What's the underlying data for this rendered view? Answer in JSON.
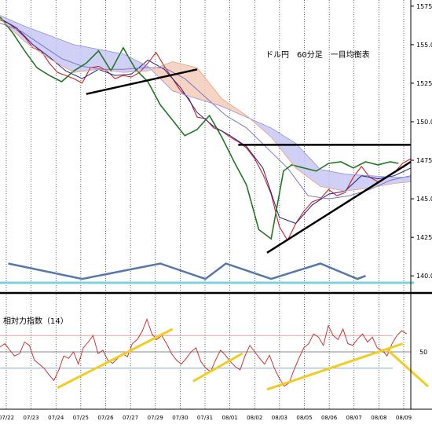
{
  "chart_data": {
    "type": "line",
    "title": "ドル円　60分足　一目均衡表",
    "price_axis": {
      "ticks": [
        157.5,
        155.0,
        152.5,
        150.0,
        147.5,
        145.0,
        142.5,
        140.0
      ],
      "tick_labels": [
        "1575",
        "155.0",
        "1525",
        "150.0",
        "1475",
        "145.0",
        "1425",
        "140.0"
      ],
      "ylim": [
        139.5,
        157.9
      ]
    },
    "dates": [
      "07/22",
      "07/23",
      "07/24",
      "07/25",
      "07/26",
      "07/27",
      "07/29",
      "07/30",
      "07/31",
      "08/01",
      "08/02",
      "08/03",
      "08/05",
      "08/06",
      "08/07",
      "08/08",
      "08/09"
    ],
    "series": [
      {
        "role": "price",
        "color": "#cc2222",
        "x": [
          0,
          2,
          4,
          6,
          8,
          10,
          12,
          14,
          16,
          18,
          20,
          22,
          24,
          26,
          28,
          30,
          32,
          34,
          36,
          38,
          40,
          42,
          44,
          46,
          48,
          50,
          52,
          54,
          56,
          58,
          60,
          62,
          64,
          66,
          68,
          70,
          72,
          74,
          76,
          78,
          80,
          82,
          84,
          86,
          88,
          90,
          92,
          94,
          96,
          98,
          100
        ],
        "y": [
          156.6,
          156.4,
          156.0,
          155.5,
          154.8,
          154.6,
          153.8,
          153.2,
          153.0,
          152.8,
          152.5,
          153.5,
          153.6,
          153.3,
          152.8,
          153.0,
          152.9,
          153.2,
          153.8,
          154.5,
          153.6,
          152.8,
          152.0,
          151.5,
          150.3,
          150.2,
          149.6,
          149.4,
          149.0,
          148.7,
          148.3,
          147.6,
          146.6,
          145.3,
          143.2,
          142.3,
          143.4,
          144.2,
          144.8,
          145.0,
          145.6,
          145.2,
          145.4,
          146.4,
          147.1,
          146.4,
          146.1,
          146.4,
          146.7,
          147.3,
          147.6
        ]
      },
      {
        "role": "tenkan",
        "color": "#22228a",
        "x": [
          0,
          4,
          8,
          12,
          16,
          20,
          24,
          28,
          32,
          36,
          40,
          44,
          48,
          52,
          56,
          60,
          64,
          68,
          72,
          76,
          80,
          84,
          88,
          92,
          96,
          100
        ],
        "y": [
          156.7,
          156.1,
          155.0,
          154.2,
          153.3,
          152.8,
          153.4,
          153.0,
          153.1,
          154.0,
          153.4,
          152.2,
          150.6,
          149.7,
          149.1,
          148.4,
          147.0,
          143.8,
          143.4,
          144.6,
          145.3,
          145.5,
          146.5,
          146.3,
          146.5,
          147.0
        ]
      },
      {
        "role": "kijun",
        "color": "#7777c8",
        "x": [
          0,
          5,
          10,
          15,
          20,
          25,
          30,
          35,
          40,
          45,
          50,
          55,
          60,
          65,
          70,
          75,
          80,
          85,
          90,
          95,
          100
        ],
        "y": [
          156.4,
          155.9,
          155.0,
          154.1,
          153.6,
          153.4,
          153.4,
          153.5,
          153.5,
          152.8,
          151.6,
          150.4,
          149.6,
          148.3,
          147.0,
          145.2,
          145.0,
          145.2,
          145.6,
          146.2,
          146.5
        ]
      },
      {
        "role": "chikou",
        "color": "#227722",
        "x": [
          0,
          3,
          6,
          9,
          12,
          15,
          18,
          21,
          24,
          27,
          30,
          33,
          36,
          39,
          42,
          45,
          48,
          51,
          54,
          57,
          60,
          63,
          66,
          69,
          71,
          74,
          77,
          80,
          83,
          86,
          89,
          92,
          95,
          97
        ],
        "y": [
          156.8,
          155.8,
          154.6,
          153.5,
          153.0,
          152.6,
          153.3,
          153.8,
          154.6,
          153.3,
          154.8,
          153.4,
          152.6,
          151.1,
          150.1,
          149.1,
          149.5,
          150.4,
          149.0,
          147.4,
          145.9,
          143.0,
          142.4,
          146.8,
          147.2,
          147.0,
          146.8,
          147.3,
          147.4,
          147.0,
          147.4,
          147.2,
          147.4,
          147.3
        ]
      },
      {
        "role": "senkou_a",
        "color": "#e8a080",
        "x": [
          0,
          6,
          12,
          18,
          24,
          30,
          36,
          42,
          48,
          54,
          60,
          66,
          72,
          78,
          84,
          90,
          96,
          100
        ],
        "y": [
          156.7,
          155.2,
          154.1,
          153.2,
          153.4,
          153.2,
          153.3,
          153.9,
          153.5,
          151.5,
          150.4,
          149.0,
          147.0,
          145.8,
          145.5,
          145.7,
          146.0,
          146.1
        ]
      },
      {
        "role": "senkou_b",
        "color": "#9090d8",
        "x": [
          0,
          6,
          12,
          18,
          24,
          30,
          36,
          42,
          48,
          54,
          60,
          66,
          72,
          78,
          84,
          90,
          96,
          100
        ],
        "y": [
          156.9,
          156.2,
          155.6,
          155.0,
          154.7,
          154.4,
          153.6,
          152.0,
          151.5,
          151.0,
          150.3,
          149.6,
          148.6,
          146.9,
          146.6,
          146.5,
          146.4,
          146.4
        ]
      }
    ],
    "resistance_line": {
      "y": 148.5,
      "x": [
        58,
        100
      ]
    },
    "support_lines": [
      {
        "from": [
          21,
          151.8
        ],
        "to": [
          48,
          153.4
        ]
      },
      {
        "from": [
          65,
          141.5
        ],
        "to": [
          100,
          147.4
        ]
      }
    ],
    "cycle_wave": {
      "color": "#5577aa",
      "points": [
        [
          2,
          140.8
        ],
        [
          20,
          139.8
        ],
        [
          39,
          140.8
        ],
        [
          50,
          139.8
        ],
        [
          55,
          140.8
        ],
        [
          66,
          139.8
        ],
        [
          78,
          140.8
        ],
        [
          87,
          139.8
        ],
        [
          89,
          140.0
        ]
      ]
    },
    "rsi": {
      "label": "相対力指数（14）",
      "upper": 70,
      "lower": 30,
      "mid_value_label": "50",
      "values": [
        56,
        60,
        52,
        45,
        48,
        62,
        58,
        40,
        35,
        30,
        22,
        15,
        28,
        45,
        42,
        50,
        35,
        55,
        62,
        70,
        48,
        52,
        40,
        36,
        42,
        48,
        44,
        60,
        65,
        75,
        90,
        72,
        65,
        70,
        60,
        48,
        40,
        35,
        42,
        50,
        55,
        38,
        30,
        26,
        40,
        52,
        46,
        38,
        32,
        28,
        45,
        58,
        50,
        42,
        35,
        46,
        30,
        18,
        8,
        12,
        28,
        42,
        55,
        60,
        72,
        68,
        58,
        82,
        70,
        65,
        78,
        60,
        58,
        66,
        72,
        62,
        68,
        55,
        52,
        45,
        60,
        70,
        76,
        72
      ],
      "trend_lines": [
        {
          "from": [
            14,
            6
          ],
          "to": [
            42,
            78
          ]
        },
        {
          "from": [
            47,
            14
          ],
          "to": [
            59,
            48
          ]
        },
        {
          "from": [
            65,
            4
          ],
          "to": [
            98,
            60
          ]
        }
      ]
    }
  }
}
